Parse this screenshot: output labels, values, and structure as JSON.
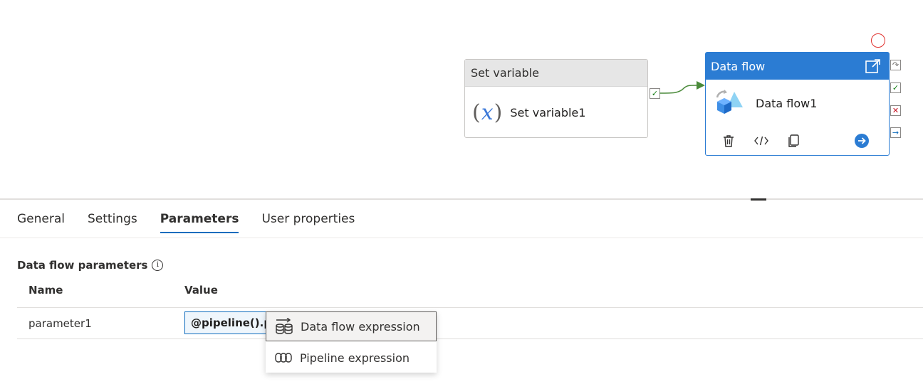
{
  "canvas": {
    "set_variable": {
      "type_label": "Set variable",
      "name": "Set variable1",
      "icon_text": "(x)"
    },
    "data_flow": {
      "type_label": "Data flow",
      "name": "Data flow1"
    }
  },
  "tabs": [
    {
      "label": "General"
    },
    {
      "label": "Settings"
    },
    {
      "label": "Parameters",
      "active": true
    },
    {
      "label": "User properties"
    }
  ],
  "parameters": {
    "section_title": "Data flow parameters",
    "columns": {
      "name": "Name",
      "value": "Value"
    },
    "rows": [
      {
        "name": "parameter1",
        "value": "@pipeline().p"
      }
    ]
  },
  "menu": {
    "items": [
      {
        "label": "Data flow expression",
        "highlighted": true
      },
      {
        "label": "Pipeline expression"
      }
    ]
  },
  "colors": {
    "accent": "#2b7cd3",
    "success": "#107c10",
    "failure": "#c50f1f",
    "link_arrow": "#4a8a3a"
  }
}
